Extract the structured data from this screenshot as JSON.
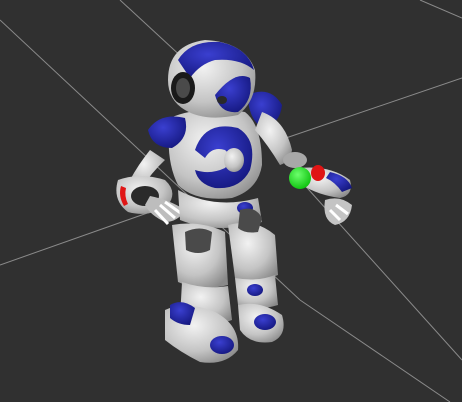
{
  "scene": {
    "background": "#303030",
    "grid_color": "#9a9a9a",
    "robot": {
      "body_color": "#d6d6d6",
      "shade_color": "#8e8e8e",
      "accent_color": "#1c1fa0",
      "joint_dark": "#3a3a3a"
    },
    "markers": {
      "green": "#15e015",
      "red": "#e01515"
    }
  }
}
